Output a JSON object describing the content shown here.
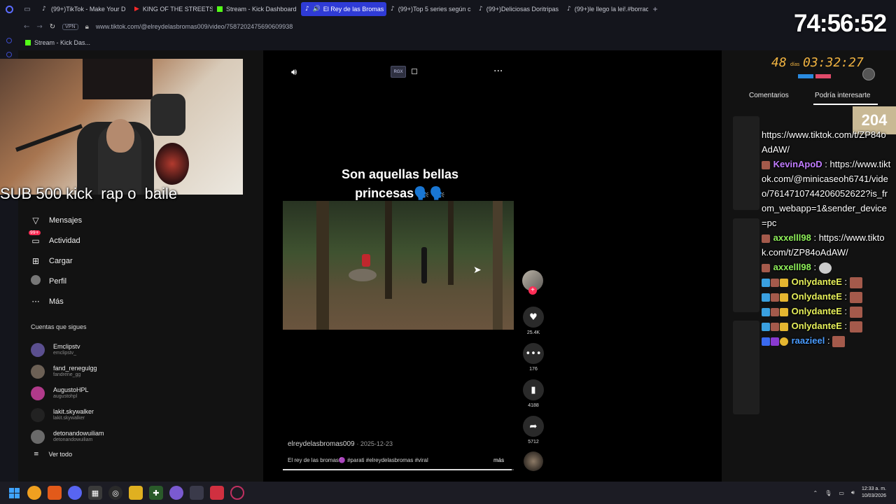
{
  "browser": {
    "tabs": [
      {
        "label": "(99+)TikTok - Make Your D",
        "icon": "tiktok-icon"
      },
      {
        "label": "KING OF THE STREETS: W",
        "icon": "youtube-icon"
      },
      {
        "label": "Stream - Kick Dashboard",
        "icon": "kick-icon"
      },
      {
        "label": "El Rey de las Bromas",
        "icon": "tiktok-icon",
        "active": true
      },
      {
        "label": "(99+)Top 5 series según c",
        "icon": "tiktok-icon"
      },
      {
        "label": "(99+)Deliciosas Doritripas",
        "icon": "tiktok-icon"
      },
      {
        "label": "(99+)le llego la lei!.#borrac",
        "icon": "tiktok-icon"
      }
    ],
    "vpn_label": "VPN",
    "url": "www.tiktok.com/@elreydelasbromas009/video/7587202475690609938",
    "bookmark": "Stream - Kick Das..."
  },
  "stream_overlay": {
    "text": "SUB 500 kick  rap o  baile",
    "big_timer": "74:56:52",
    "days": "48",
    "days_label": "días",
    "days_time": "03:32:27",
    "count_badge": "204"
  },
  "sidebar": {
    "items": [
      {
        "label": "Mensajes",
        "icon": "send-icon"
      },
      {
        "label": "Actividad",
        "icon": "inbox-icon",
        "badge": "99+"
      },
      {
        "label": "Cargar",
        "icon": "upload-icon"
      },
      {
        "label": "Perfil",
        "icon": "avatar"
      },
      {
        "label": "Más",
        "icon": "more-icon"
      }
    ],
    "following_title": "Cuentas que sigues",
    "following": [
      {
        "name": "Emclipstv",
        "handle": "emclipstv_"
      },
      {
        "name": "fand_renegulgg",
        "handle": "fandrene_gg"
      },
      {
        "name": "AugustoHPL",
        "handle": "augustohpl"
      },
      {
        "name": "lakit.skywalker",
        "handle": "lakit.skywalker"
      },
      {
        "name": "detonandowuiliam",
        "handle": "detonandowuiliam"
      }
    ],
    "see_all": "Ver todo"
  },
  "video": {
    "caption_line1": "Son aquellas bellas",
    "caption_line2": "princesas🗣️🗣️",
    "rgx_label": "RGX",
    "author": "elreydelasbromas009",
    "date": "2025-12-23",
    "description": "El rey de las bromas🟣 #parati #elreydelasbromas #viral",
    "more_label": "más",
    "progress": 0.99,
    "likes": "25.4K",
    "comments": "176",
    "saves": "4188",
    "shares": "5712"
  },
  "right_panel": {
    "tab_comments": "Comentarios",
    "tab_interest": "Podría interesarte"
  },
  "chat": [
    {
      "user": "",
      "text": "https://www.tiktok.com/t/ZP84oAdAW/"
    },
    {
      "user": "KevinApoD",
      "color": "#c07cff",
      "text": "https://www.tiktok.com/@minicaseoh6741/video/7614710744206052622?is_from_webapp=1&sender_device=pc"
    },
    {
      "user": "axxelll98",
      "color": "#8ff05a",
      "text": "https://www.tiktok.com/t/ZP84oAdAW/"
    },
    {
      "user": "axxelll98",
      "color": "#8ff05a",
      "text": ""
    },
    {
      "user": "OnlydanteE",
      "color": "#e7f05a",
      "text": ""
    },
    {
      "user": "OnlydanteE",
      "color": "#e7f05a",
      "text": ""
    },
    {
      "user": "OnlydanteE",
      "color": "#e7f05a",
      "text": ""
    },
    {
      "user": "OnlydanteE",
      "color": "#e7f05a",
      "text": ""
    },
    {
      "user": "raazieel",
      "color": "#4a9cff",
      "text": ""
    }
  ],
  "taskbar": {
    "time": "12:33 a. m.",
    "date": "10/03/2026"
  }
}
